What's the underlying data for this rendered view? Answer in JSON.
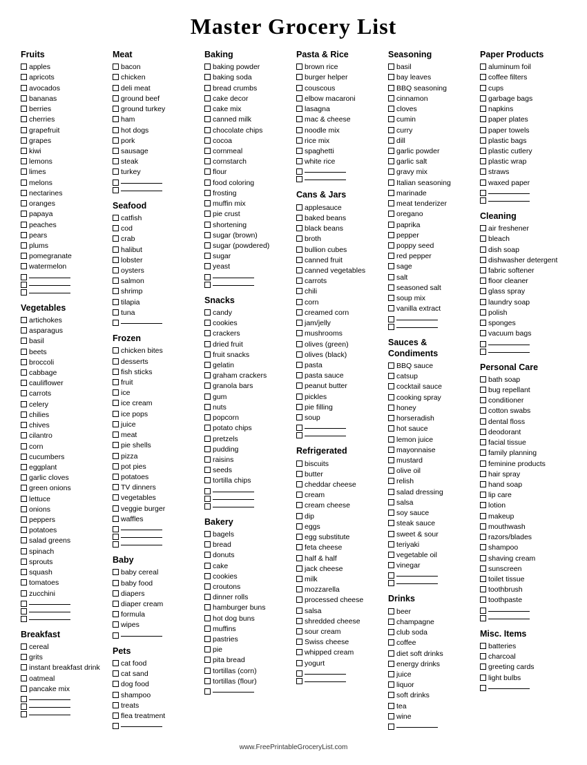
{
  "title": "Master Grocery List",
  "footer": "www.FreePrintableGroceryList.com",
  "columns": [
    {
      "sections": [
        {
          "title": "Fruits",
          "items": [
            "apples",
            "apricots",
            "avocados",
            "bananas",
            "berries",
            "cherries",
            "grapefruit",
            "grapes",
            "kiwi",
            "lemons",
            "limes",
            "melons",
            "nectarines",
            "oranges",
            "papaya",
            "peaches",
            "pears",
            "plums",
            "pomegranate",
            "watermelon"
          ],
          "blanks": 3
        },
        {
          "title": "Vegetables",
          "items": [
            "artichokes",
            "asparagus",
            "basil",
            "beets",
            "broccoli",
            "cabbage",
            "cauliflower",
            "carrots",
            "celery",
            "chilies",
            "chives",
            "cilantro",
            "corn",
            "cucumbers",
            "eggplant",
            "garlic cloves",
            "green onions",
            "lettuce",
            "onions",
            "peppers",
            "potatoes",
            "salad greens",
            "spinach",
            "sprouts",
            "squash",
            "tomatoes",
            "zucchini"
          ],
          "blanks": 3
        },
        {
          "title": "Breakfast",
          "items": [
            "cereal",
            "grits",
            "instant breakfast drink",
            "oatmeal",
            "pancake mix"
          ],
          "blanks": 3
        }
      ]
    },
    {
      "sections": [
        {
          "title": "Meat",
          "items": [
            "bacon",
            "chicken",
            "deli meat",
            "ground beef",
            "ground turkey",
            "ham",
            "hot dogs",
            "pork",
            "sausage",
            "steak",
            "turkey"
          ],
          "blanks": 2
        },
        {
          "title": "Seafood",
          "items": [
            "catfish",
            "cod",
            "crab",
            "halibut",
            "lobster",
            "oysters",
            "salmon",
            "shrimp",
            "tilapia",
            "tuna"
          ],
          "blanks": 1
        },
        {
          "title": "Frozen",
          "items": [
            "chicken bites",
            "desserts",
            "fish sticks",
            "fruit",
            "ice",
            "ice cream",
            "ice pops",
            "juice",
            "meat",
            "pie shells",
            "pizza",
            "pot pies",
            "potatoes",
            "TV dinners",
            "vegetables",
            "veggie burger",
            "waffles"
          ],
          "blanks": 3
        },
        {
          "title": "Baby",
          "items": [
            "baby cereal",
            "baby food",
            "diapers",
            "diaper cream",
            "formula",
            "wipes"
          ],
          "blanks": 1
        },
        {
          "title": "Pets",
          "items": [
            "cat food",
            "cat sand",
            "dog food",
            "shampoo",
            "treats",
            "flea treatment"
          ],
          "blanks": 1
        }
      ]
    },
    {
      "sections": [
        {
          "title": "Baking",
          "items": [
            "baking powder",
            "baking soda",
            "bread crumbs",
            "cake decor",
            "cake mix",
            "canned milk",
            "chocolate chips",
            "cocoa",
            "cornmeal",
            "cornstarch",
            "flour",
            "food coloring",
            "frosting",
            "muffin mix",
            "pie crust",
            "shortening",
            "sugar (brown)",
            "sugar (powdered)",
            "sugar",
            "yeast"
          ],
          "blanks": 2
        },
        {
          "title": "Snacks",
          "items": [
            "candy",
            "cookies",
            "crackers",
            "dried fruit",
            "fruit snacks",
            "gelatin",
            "graham crackers",
            "granola bars",
            "gum",
            "nuts",
            "popcorn",
            "potato chips",
            "pretzels",
            "pudding",
            "raisins",
            "seeds",
            "tortilla chips"
          ],
          "blanks": 3
        },
        {
          "title": "Bakery",
          "items": [
            "bagels",
            "bread",
            "donuts",
            "cake",
            "cookies",
            "croutons",
            "dinner rolls",
            "hamburger buns",
            "hot dog buns",
            "muffins",
            "pastries",
            "pie",
            "pita bread",
            "tortillas (corn)",
            "tortillas (flour)"
          ],
          "blanks": 1
        }
      ]
    },
    {
      "sections": [
        {
          "title": "Pasta & Rice",
          "items": [
            "brown rice",
            "burger helper",
            "couscous",
            "elbow macaroni",
            "lasagna",
            "mac & cheese",
            "noodle mix",
            "rice mix",
            "spaghetti",
            "white rice"
          ],
          "blanks": 2
        },
        {
          "title": "Cans & Jars",
          "items": [
            "applesauce",
            "baked beans",
            "black beans",
            "broth",
            "bullion cubes",
            "canned fruit",
            "canned vegetables",
            "carrots",
            "chili",
            "corn",
            "creamed corn",
            "jam/jelly",
            "mushrooms",
            "olives (green)",
            "olives (black)",
            "pasta",
            "pasta sauce",
            "peanut butter",
            "pickles",
            "pie filling",
            "soup"
          ],
          "blanks": 2
        },
        {
          "title": "Refrigerated",
          "items": [
            "biscuits",
            "butter",
            "cheddar cheese",
            "cream",
            "cream cheese",
            "dip",
            "eggs",
            "egg substitute",
            "feta cheese",
            "half & half",
            "jack cheese",
            "milk",
            "mozzarella",
            "processed cheese",
            "salsa",
            "shredded cheese",
            "sour cream",
            "Swiss cheese",
            "whipped cream",
            "yogurt"
          ],
          "blanks": 2
        }
      ]
    },
    {
      "sections": [
        {
          "title": "Seasoning",
          "items": [
            "basil",
            "bay leaves",
            "BBQ seasoning",
            "cinnamon",
            "cloves",
            "cumin",
            "curry",
            "dill",
            "garlic powder",
            "garlic salt",
            "gravy mix",
            "Italian seasoning",
            "marinade",
            "meat tenderizer",
            "oregano",
            "paprika",
            "pepper",
            "poppy seed",
            "red pepper",
            "sage",
            "salt",
            "seasoned salt",
            "soup mix",
            "vanilla extract"
          ],
          "blanks": 2
        },
        {
          "title": "Sauces & Condiments",
          "items": [
            "BBQ sauce",
            "catsup",
            "cocktail sauce",
            "cooking spray",
            "honey",
            "horseradish",
            "hot sauce",
            "lemon juice",
            "mayonnaise",
            "mustard",
            "olive oil",
            "relish",
            "salad dressing",
            "salsa",
            "soy sauce",
            "steak sauce",
            "sweet & sour",
            "teriyaki",
            "vegetable oil",
            "vinegar"
          ],
          "blanks": 2
        },
        {
          "title": "Drinks",
          "items": [
            "beer",
            "champagne",
            "club soda",
            "coffee",
            "diet soft drinks",
            "energy drinks",
            "juice",
            "liquor",
            "soft drinks",
            "tea",
            "wine"
          ],
          "blanks": 1
        }
      ]
    },
    {
      "sections": [
        {
          "title": "Paper Products",
          "items": [
            "aluminum foil",
            "coffee filters",
            "cups",
            "garbage bags",
            "napkins",
            "paper plates",
            "paper towels",
            "plastic bags",
            "plastic cutlery",
            "plastic wrap",
            "straws",
            "waxed paper"
          ],
          "blanks": 2
        },
        {
          "title": "Cleaning",
          "items": [
            "air freshener",
            "bleach",
            "dish soap",
            "dishwasher detergent",
            "fabric softener",
            "floor cleaner",
            "glass spray",
            "laundry soap",
            "polish",
            "sponges",
            "vacuum bags"
          ],
          "blanks": 2
        },
        {
          "title": "Personal Care",
          "items": [
            "bath soap",
            "bug repellant",
            "conditioner",
            "cotton swabs",
            "dental floss",
            "deodorant",
            "facial tissue",
            "family planning",
            "feminine products",
            "hair spray",
            "hand soap",
            "lip care",
            "lotion",
            "makeup",
            "mouthwash",
            "razors/blades",
            "shampoo",
            "shaving cream",
            "sunscreen",
            "toilet tissue",
            "toothbrush",
            "toothpaste"
          ],
          "blanks": 2
        },
        {
          "title": "Misc. Items",
          "items": [
            "batteries",
            "charcoal",
            "greeting cards",
            "light bulbs"
          ],
          "blanks": 1
        }
      ]
    }
  ]
}
